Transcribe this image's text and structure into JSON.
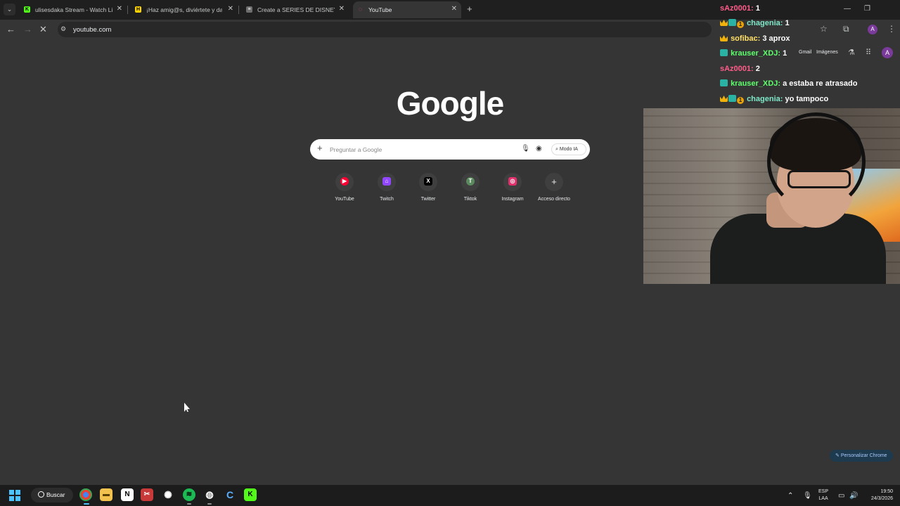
{
  "browser": {
    "tabs": [
      {
        "title": "ulisesdaka Stream - Watch Live",
        "favicon_color": "#53fc18",
        "favicon_glyph": "K"
      },
      {
        "title": "¡Haz amig@s, diviértete y date",
        "favicon_color": "#ffd400",
        "favicon_glyph": "H"
      },
      {
        "title": "Create a SERIES DE DISNEY CH",
        "favicon_color": "#6e6e6e",
        "favicon_glyph": "≡"
      },
      {
        "title": "YouTube",
        "favicon_color": "#ff4e7a",
        "favicon_glyph": "◌",
        "active": true
      }
    ],
    "url": "youtube.com"
  },
  "ntp": {
    "links": {
      "gmail": "Gmail",
      "images": "Imágenes"
    },
    "logo_text": "Google",
    "search_placeholder": "Preguntar a Google",
    "ai_mode_label": "Modo IA",
    "shortcuts": [
      {
        "label": "YouTube",
        "icon": "youtube-icon",
        "color": "#ff0033",
        "glyph": "▶"
      },
      {
        "label": "Twitch",
        "icon": "twitch-icon",
        "color": "#9146ff",
        "glyph": "⌂"
      },
      {
        "label": "Twitter",
        "icon": "x-icon",
        "color": "#000000",
        "glyph": "X"
      },
      {
        "label": "Tiktok",
        "icon": "tiktok-letter-icon",
        "color": "#5b8a5e",
        "glyph": "T"
      },
      {
        "label": "Instagram",
        "icon": "instagram-icon",
        "color": "#e1306c",
        "glyph": "◎"
      },
      {
        "label": "Acceso directo",
        "icon": "add-shortcut-icon",
        "color": "#3f3f3f",
        "glyph": "+"
      }
    ],
    "customize_label": "Personalizar Chrome"
  },
  "chat": [
    {
      "user": "sAz0001:",
      "message": "1",
      "color": "#ff5c8a",
      "badges": []
    },
    {
      "user": "chagenia:",
      "message": "1",
      "color": "#7ee8c8",
      "badges": [
        "crown",
        "vip",
        "one"
      ]
    },
    {
      "user": "sofibac:",
      "message": "3 aprox",
      "color": "#ffe066",
      "badges": [
        "crown"
      ]
    },
    {
      "user": "krauser_XDJ:",
      "message": "1",
      "color": "#5cff6b",
      "badges": [
        "vip"
      ]
    },
    {
      "user": "sAz0001:",
      "message": "2",
      "color": "#ff5c8a",
      "badges": []
    },
    {
      "user": "krauser_XDJ:",
      "message": "a estaba re atrasado",
      "color": "#5cff6b",
      "badges": [
        "vip"
      ]
    },
    {
      "user": "chagenia:",
      "message": "yo tampoco",
      "color": "#7ee8c8",
      "badges": [
        "crown",
        "vip",
        "one"
      ]
    }
  ],
  "taskbar": {
    "search_label": "Buscar",
    "language": {
      "line1": "ESP",
      "line2": "LAA"
    },
    "time": "19:50",
    "date": "24/3/2026"
  }
}
